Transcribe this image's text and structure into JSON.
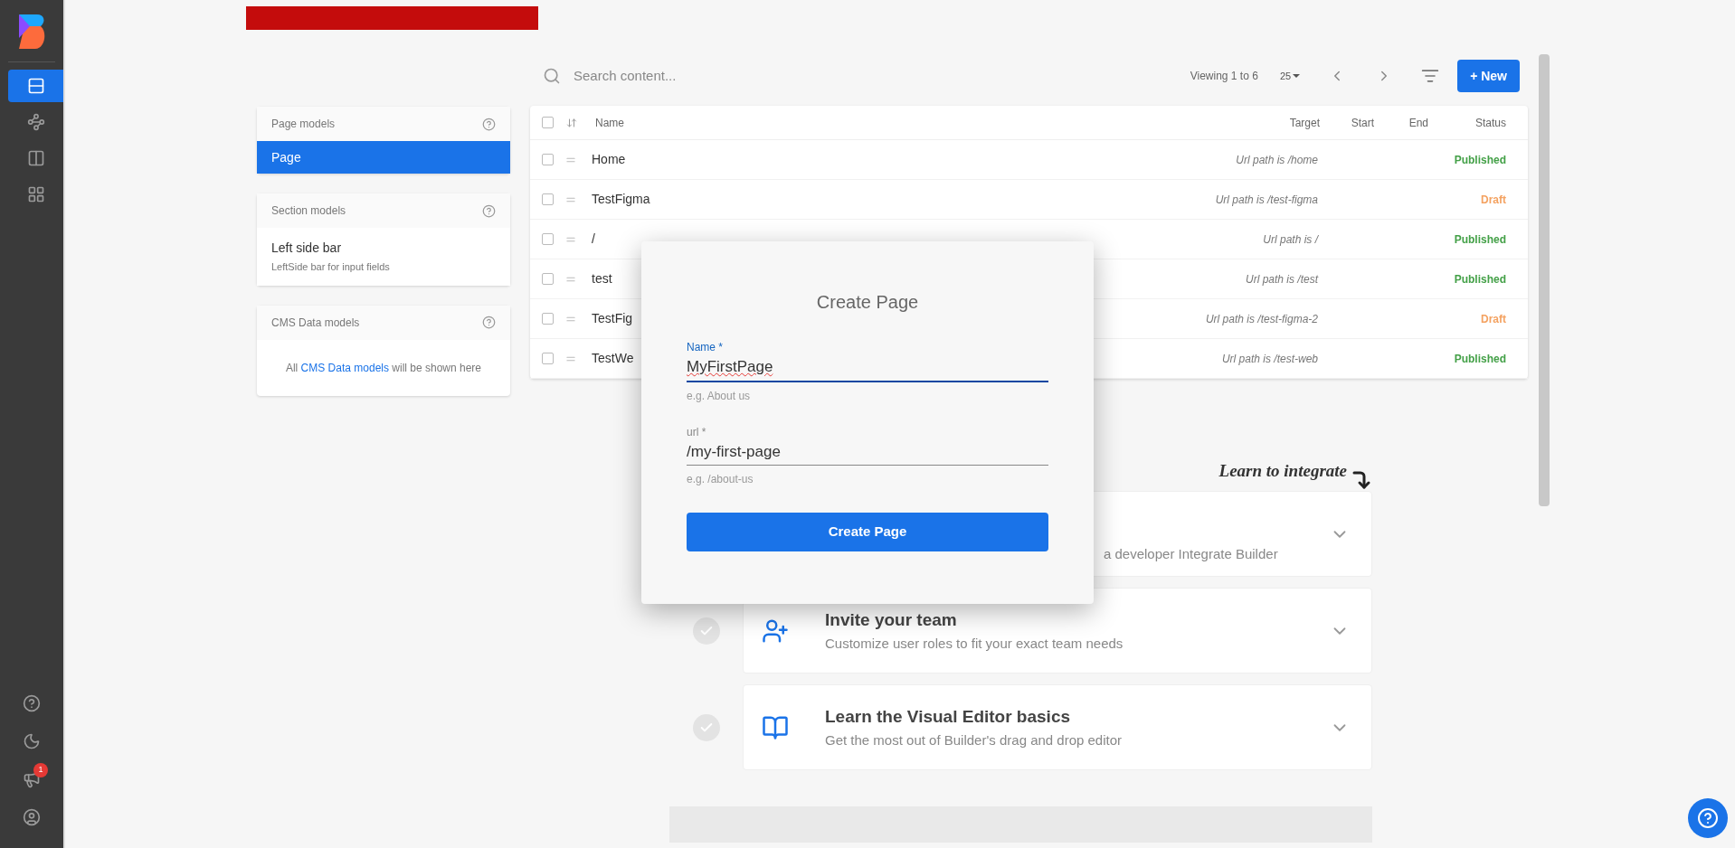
{
  "sidebar": {
    "items": [
      {
        "kind": "content",
        "selected": true
      },
      {
        "kind": "graph",
        "selected": false
      },
      {
        "kind": "columns",
        "selected": false
      },
      {
        "kind": "apps",
        "selected": false
      }
    ],
    "bottom_items": [
      {
        "kind": "help"
      },
      {
        "kind": "theme"
      },
      {
        "kind": "announcements",
        "badge": "1"
      },
      {
        "kind": "account"
      }
    ]
  },
  "toolbar": {
    "search_placeholder": "Search content...",
    "viewing": "Viewing 1 to 6",
    "page_size": "25",
    "new_button": "+ New"
  },
  "model_panels": [
    {
      "title": "Page models",
      "items": [
        {
          "title": "Page",
          "selected": true
        }
      ]
    },
    {
      "title": "Section models",
      "items": [
        {
          "title": "Left side bar",
          "description": "LeftSide bar for input fields",
          "selected": false
        }
      ]
    },
    {
      "title": "CMS Data models",
      "empty_before": "All ",
      "empty_link": "CMS Data models",
      "empty_after": " will be shown here"
    }
  ],
  "table": {
    "columns": [
      "Name",
      "Target",
      "Start",
      "End",
      "Status"
    ],
    "all_checked": false,
    "rows": [
      {
        "checked": false,
        "name": "Home",
        "target": "Url path is /home",
        "status": "Published",
        "color": "#43a047"
      },
      {
        "checked": false,
        "name": "TestFigma",
        "target": "Url path is /test-figma",
        "status": "Draft",
        "color": "#f4a261"
      },
      {
        "checked": false,
        "name": "/",
        "target": "Url path is /",
        "status": "Published",
        "color": "#43a047"
      },
      {
        "checked": false,
        "name": "test",
        "target": "Url path is /test",
        "status": "Published",
        "color": "#43a047"
      },
      {
        "checked": false,
        "name": "TestFig",
        "target": "Url path is /test-figma-2",
        "status": "Draft",
        "color": "#f4a261"
      },
      {
        "checked": false,
        "name": "TestWe",
        "target": "Url path is /test-web",
        "status": "Published",
        "color": "#43a047"
      }
    ]
  },
  "learn": {
    "heading": "Learn to integrate",
    "cards": [
      {
        "kind": "hidden",
        "subtitle": "a developer Integrate Builder"
      },
      {
        "kind": "team",
        "title": "Invite your team",
        "subtitle": "Customize user roles to fit your exact team needs"
      },
      {
        "kind": "book",
        "title": "Learn the Visual Editor basics",
        "subtitle": "Get the most out of Builder's drag and drop editor"
      }
    ]
  },
  "dialog": {
    "title": "Create Page",
    "fields": [
      {
        "label": "Name *",
        "value": "MyFirstPage",
        "helper": "e.g. About us",
        "focused": true,
        "misspelled": true
      },
      {
        "label": "url *",
        "value": "/my-first-page",
        "helper": "e.g. /about-us",
        "focused": false,
        "misspelled": false
      }
    ],
    "button": "Create Page"
  }
}
